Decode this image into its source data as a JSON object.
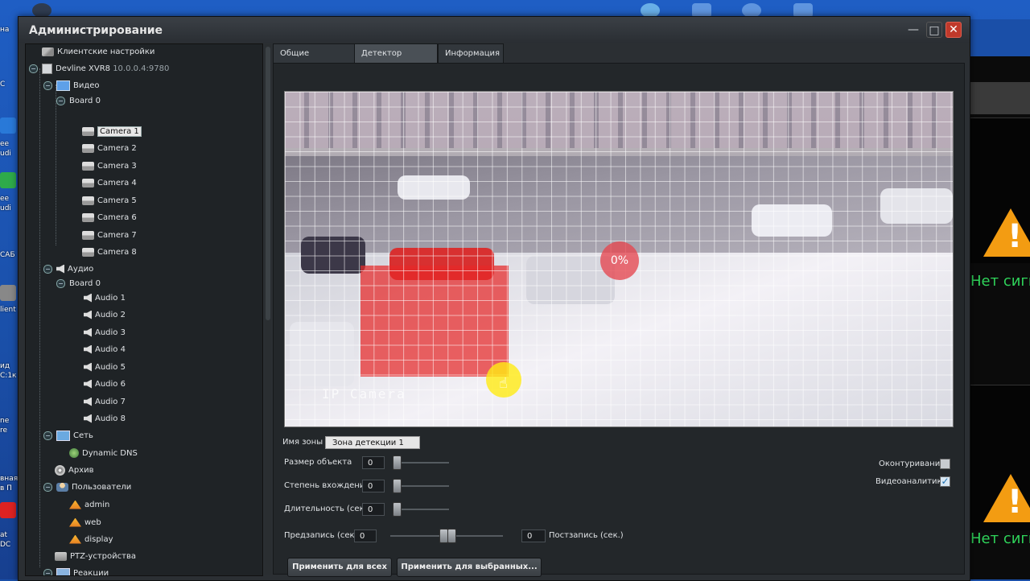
{
  "window": {
    "title": "Администрирование"
  },
  "tree": {
    "root_settings": "Клиентские настройки",
    "server": {
      "name": "Devline XVR8",
      "address": "10.0.0.4:9780"
    },
    "video": {
      "label": "Видео",
      "board": "Board 0",
      "cameras": [
        "Camera 1",
        "Camera 2",
        "Camera 3",
        "Camera 4",
        "Camera 5",
        "Camera 6",
        "Camera 7",
        "Camera 8"
      ]
    },
    "audio": {
      "label": "Аудио",
      "board": "Board 0",
      "channels": [
        "Audio 1",
        "Audio 2",
        "Audio 3",
        "Audio 4",
        "Audio 5",
        "Audio 6",
        "Audio 7",
        "Audio 8"
      ]
    },
    "network": {
      "label": "Сеть",
      "child": "Dynamic DNS"
    },
    "archive": "Архив",
    "users": {
      "label": "Пользователи",
      "items": [
        "admin",
        "web",
        "display"
      ]
    },
    "ptz": "PTZ-устройства",
    "reactions": "Реакции",
    "selected": "Camera 1"
  },
  "tabs": [
    {
      "label": "Общие настройки",
      "active": false
    },
    {
      "label": "Детектор движения",
      "active": true
    },
    {
      "label": "Информация",
      "active": false
    }
  ],
  "video": {
    "overlay_text": "IP Camera",
    "motion_percent": "0%"
  },
  "form": {
    "zone_name_label": "Имя зоны",
    "zone_name_value": "Зона детекции 1",
    "object_size_label": "Размер объекта",
    "object_size_value": "0",
    "entry_degree_label": "Степень вхождения",
    "entry_degree_value": "0",
    "duration_label": "Длительность (сек.)",
    "duration_value": "0",
    "prerecord_label": "Предзапись (сек.)",
    "prerecord_value": "0",
    "postrecord_label": "Постзапись (сек.)",
    "postrecord_value": "0",
    "contour_label": "Оконтуривание",
    "contour_checked": false,
    "analytics_label": "Видеоаналитика",
    "analytics_checked": true,
    "apply_all": "Применить для всех",
    "apply_selected": "Применить для выбранных..."
  },
  "desktop": {
    "right_text_top": "Нет сигн",
    "right_text_bottom": "Нет сигн",
    "left_labels": [
      "на",
      "C",
      "ee",
      "udi",
      "ee",
      "udi",
      "САБ",
      "lient",
      "ид",
      "С:1к",
      "ne",
      "re",
      "вная",
      "в П",
      "at",
      "DC"
    ]
  },
  "colors": {
    "motion_zone": "#e62828",
    "accent_close": "#c0392b",
    "no_signal": "#2fd35a"
  }
}
